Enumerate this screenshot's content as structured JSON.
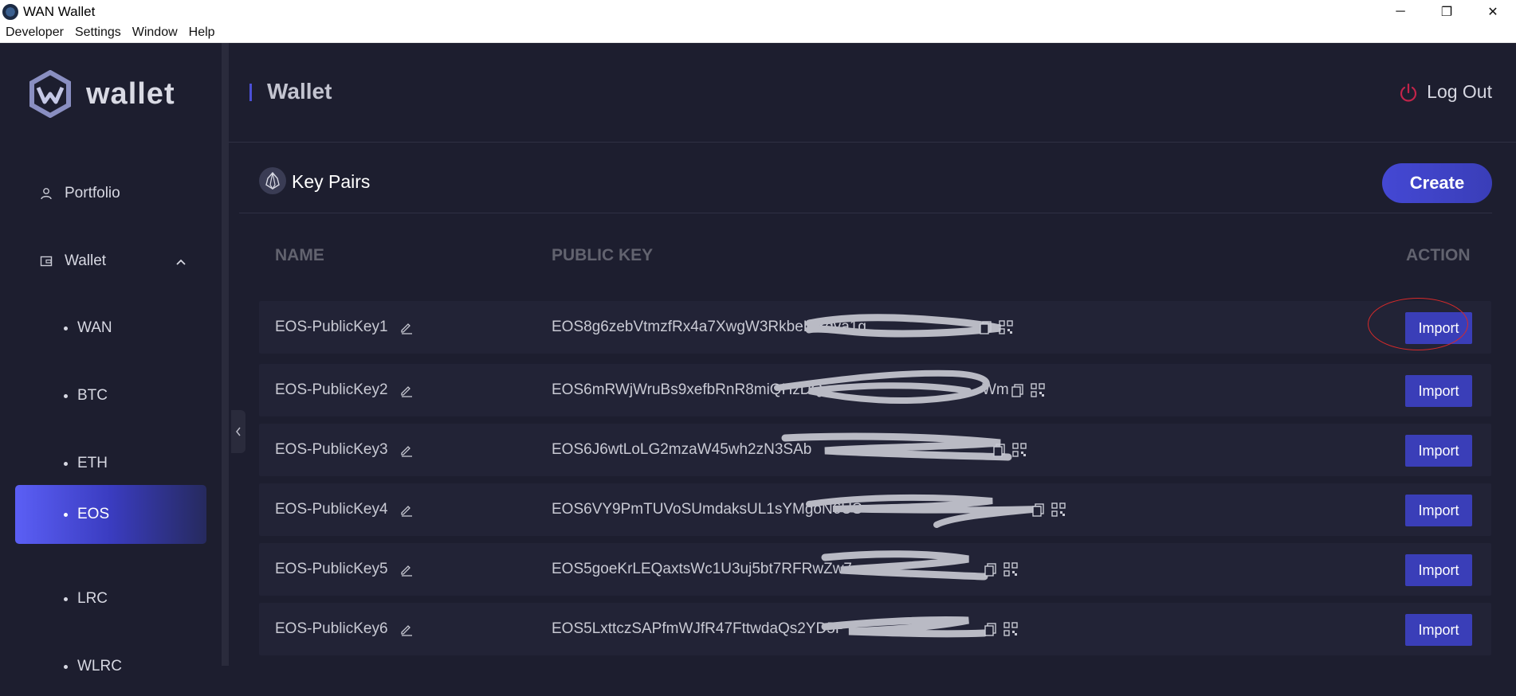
{
  "window": {
    "title": "WAN Wallet",
    "controls": [
      "─",
      "❐",
      "✕"
    ]
  },
  "menu": [
    "Developer",
    "Settings",
    "Window",
    "Help"
  ],
  "logo": {
    "text": "wallet"
  },
  "sidebar": {
    "portfolio": "Portfolio",
    "wallet": "Wallet",
    "coins": [
      "WAN",
      "BTC",
      "ETH",
      "EOS",
      "LRC",
      "WLRC"
    ],
    "active": "EOS"
  },
  "header": {
    "title": "Wallet",
    "logout": "Log Out"
  },
  "card": {
    "title": "Key Pairs",
    "create": "Create"
  },
  "table": {
    "headers": {
      "name": "NAME",
      "key": "PUBLIC KEY",
      "action": "ACTION"
    },
    "rows": [
      {
        "name": "EOS-PublicKey1",
        "key": "EOS8g6zebVtmzfRx4a7XwgW3RkbeLiBdva1g",
        "action": "Import"
      },
      {
        "name": "EOS-PublicKey2",
        "key": "EOS6mRWjWruBs9xefbRnR8miQHzDQ",
        "key_tail": "Wm",
        "action": "Import"
      },
      {
        "name": "EOS-PublicKey3",
        "key": "EOS6J6wtLoLG2mzaW45wh2zN3SAb",
        "action": "Import"
      },
      {
        "name": "EOS-PublicKey4",
        "key": "EOS6VY9PmTUVoSUmdaksUL1sYMgoN6US",
        "action": "Import"
      },
      {
        "name": "EOS-PublicKey5",
        "key": "EOS5goeKrLEQaxtsWc1U3uj5bt7RFRwZw7",
        "action": "Import"
      },
      {
        "name": "EOS-PublicKey6",
        "key": "EOS5LxttczSAPfmWJfR47FttwdaQs2YD5P",
        "action": "Import"
      }
    ]
  },
  "colors": {
    "background": "#1d1e2f",
    "accent": "#3a3eb8",
    "active_gradient_start": "#5b5ff5",
    "logout_icon": "#c2244a",
    "highlight_ring": "#d62a2a"
  },
  "icons": [
    "app-icon",
    "wallet-logo-icon",
    "user-icon",
    "wallet-icon",
    "chevron-up-icon",
    "power-icon",
    "eos-icon",
    "edit-icon",
    "copy-icon",
    "qr-code-icon",
    "chevron-left-icon"
  ]
}
